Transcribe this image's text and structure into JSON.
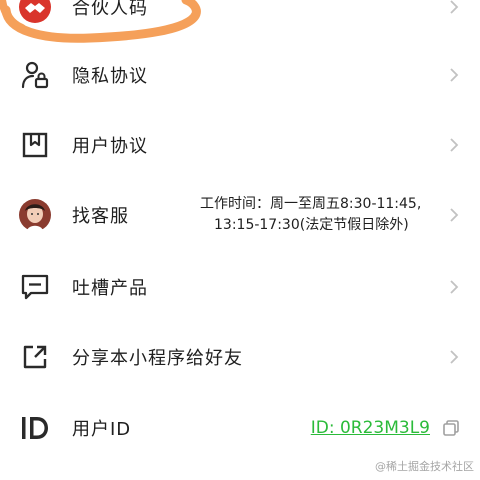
{
  "menu": {
    "items": [
      {
        "label": "合伙人码",
        "icon": "handshake-icon"
      },
      {
        "label": "隐私协议",
        "icon": "user-lock-icon"
      },
      {
        "label": "用户协议",
        "icon": "bookmark-doc-icon"
      },
      {
        "label": "找客服",
        "icon": "avatar"
      },
      {
        "label": "吐槽产品",
        "icon": "feedback-message-icon"
      },
      {
        "label": "分享本小程序给好友",
        "icon": "share-external-icon"
      },
      {
        "label": "用户ID",
        "icon": "id-icon"
      }
    ],
    "service_hours_line1": "工作时间：周一至周五8:30-11:45,",
    "service_hours_line2": "13:15-17:30(法定节假日除外)",
    "user_id_text": "ID: 0R23M3L9"
  },
  "watermark": "@稀土掘金技术社区",
  "colors": {
    "link_green": "#2bbb3a",
    "scribble_orange": "#f5a05a",
    "icon_dark": "#2a2a2a",
    "chevron": "#c2c2c2",
    "handshake_red": "#d9342b"
  }
}
